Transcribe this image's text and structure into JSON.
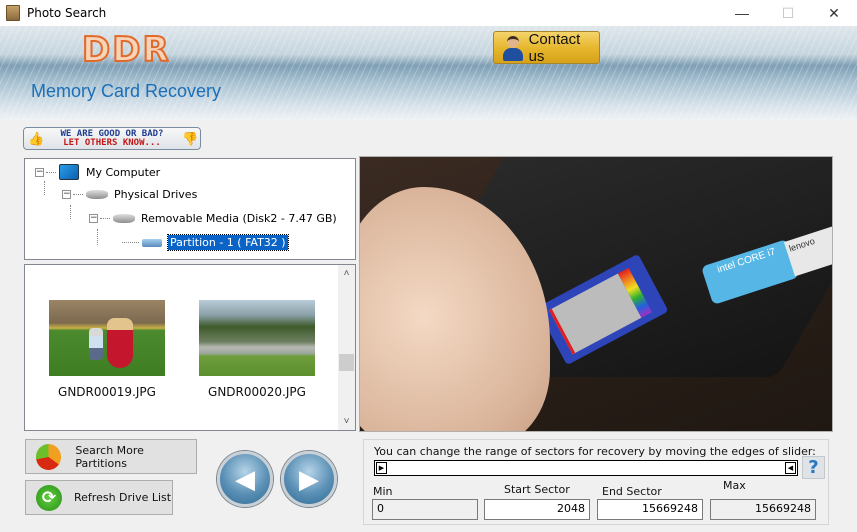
{
  "window": {
    "title": "Photo Search",
    "controls": {
      "minimize": "—",
      "maximize": "☐",
      "close": "✕"
    }
  },
  "header": {
    "logo": "DDR",
    "subtitle": "Memory Card Recovery",
    "contact_label": "Contact us"
  },
  "feedback": {
    "line1": "WE ARE GOOD OR BAD?",
    "line2": "LET OTHERS KNOW...",
    "thumb_up_icon": "👍",
    "thumb_down_icon": "👎"
  },
  "tree": {
    "nodes": [
      {
        "label": "My Computer",
        "icon": "computer-icon",
        "expanded": true
      },
      {
        "label": "Physical Drives",
        "icon": "drive-icon",
        "expanded": true
      },
      {
        "label": "Removable Media (Disk2 - 7.47 GB)",
        "icon": "drive-icon",
        "expanded": true
      },
      {
        "label": "Partition - 1 ( FAT32 )",
        "icon": "usb-drive-icon",
        "selected": true
      }
    ],
    "expander_glyph": "−"
  },
  "thumbnails": {
    "items": [
      {
        "name": "GNDR00019.JPG"
      },
      {
        "name": "GNDR00020.JPG"
      }
    ],
    "scroll_up": "˄",
    "scroll_down": "˅"
  },
  "preview": {
    "intel_label": "intel CORE i7",
    "lenovo_label": "lenovo"
  },
  "actions": {
    "search_more": "Search More Partitions",
    "refresh": "Refresh Drive List",
    "refresh_glyph": "⟳",
    "prev_glyph": "◀",
    "next_glyph": "▶"
  },
  "sector_range": {
    "caption": "You can change the range of sectors for recovery by moving the edges of slider:",
    "help_glyph": "?",
    "left_handle_glyph": "▶",
    "right_handle_glyph": "◀",
    "min_label": "Min",
    "min_value": "0",
    "start_label": "Start Sector",
    "start_value": "2048",
    "end_label": "End Sector",
    "end_value": "15669248",
    "max_label": "Max",
    "max_value": "15669248"
  }
}
